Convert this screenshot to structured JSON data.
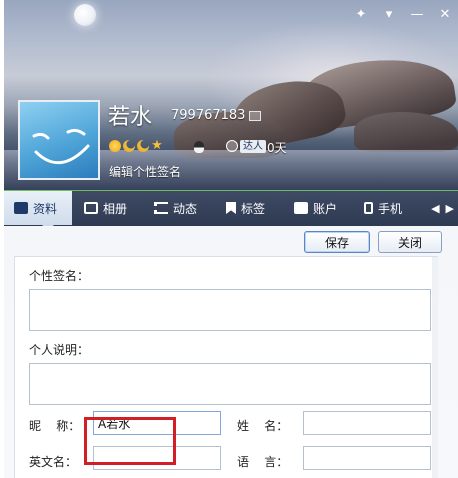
{
  "window": {
    "controls": [
      "✦",
      "▾",
      "—",
      "✕"
    ]
  },
  "profile": {
    "nickname": "若水",
    "qq_number": "799767183",
    "active_badge": "达人",
    "active_days": "0天",
    "signature_link": "编辑个性签名"
  },
  "tabs": [
    {
      "label": "资料",
      "icon": "profile-icon",
      "active": true
    },
    {
      "label": "相册",
      "icon": "album-icon",
      "active": false
    },
    {
      "label": "动态",
      "icon": "feed-icon",
      "active": false
    },
    {
      "label": "标签",
      "icon": "tag-icon",
      "active": false
    },
    {
      "label": "账户",
      "icon": "account-icon",
      "active": false
    },
    {
      "label": "手机",
      "icon": "phone-icon",
      "active": false
    }
  ],
  "tab_more": [
    "◀",
    "▶"
  ],
  "actions": {
    "save_label": "保存",
    "close_label": "关闭"
  },
  "form": {
    "signature_label": "个性签名：",
    "signature_value": "",
    "description_label": "个人说明：",
    "description_value": "",
    "nickname_label": "昵    称：",
    "nickname_value": "A若水",
    "name_label": "姓    名：",
    "name_value": "",
    "english_name_label": "英文名：",
    "english_name_value": "",
    "language_label": "语    言：",
    "language_value": ""
  },
  "colors": {
    "tab_bar": "#2e3a52",
    "highlight": "#d21f26",
    "accent": "#5a86c8"
  }
}
